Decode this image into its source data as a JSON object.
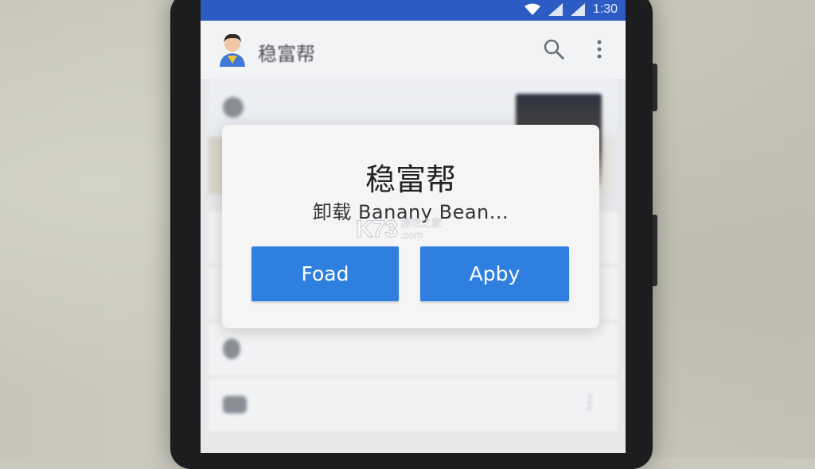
{
  "status_bar": {
    "time": "1:30",
    "icons": [
      "wifi-icon",
      "signal-icon",
      "signal-icon",
      "battery-icon"
    ]
  },
  "app_bar": {
    "title": "稳富帮",
    "icons": [
      "avatar-icon",
      "search-icon",
      "more-vert-icon"
    ]
  },
  "dialog": {
    "title": "稳富帮",
    "message": "卸载 Banany Bean...",
    "left_button": "Foad",
    "right_button": "Apby"
  },
  "watermark": {
    "logo": "K73",
    "tagline": "游戏之家",
    "domain": ".com"
  },
  "colors": {
    "status_bar": "#2d5bc4",
    "button": "#2f7fe0",
    "dialog_bg": "#f5f5f6"
  }
}
